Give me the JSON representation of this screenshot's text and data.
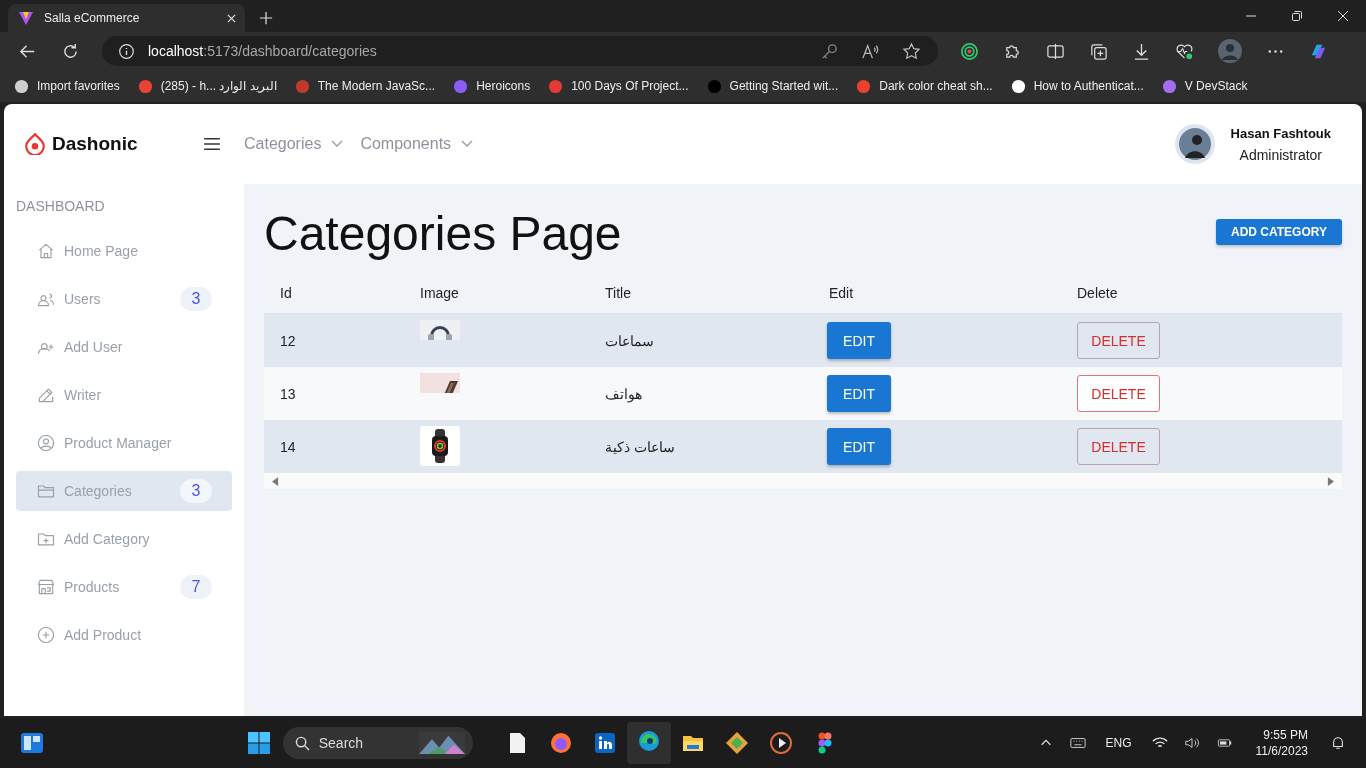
{
  "browser": {
    "tab_title": "Salla eCommerce",
    "url_host": "localhost",
    "url_path": ":5173/dashboard/categories",
    "bookmarks": [
      {
        "label": "Import favorites",
        "color": "#cfcfcf"
      },
      {
        "label": "(285) - h... البريد الوارد",
        "color": "#ea4335"
      },
      {
        "label": "The Modern JavaSc...",
        "color": "#c0392b"
      },
      {
        "label": "Heroicons",
        "color": "#8b5cf6"
      },
      {
        "label": "100 Days Of Project...",
        "color": "#e53935"
      },
      {
        "label": "Getting Started wit...",
        "color": "#000000"
      },
      {
        "label": "Dark color cheat sh...",
        "color": "#e8412c"
      },
      {
        "label": "How to Authenticat...",
        "color": "#ffffff"
      },
      {
        "label": "V DevStack",
        "color": "#a46ef0"
      }
    ]
  },
  "app": {
    "brand": "Dashonic",
    "nav": [
      "Categories",
      "Components"
    ],
    "user": {
      "name": "Hasan Fashtouk",
      "role": "Administrator"
    },
    "sidebar": {
      "section": "DASHBOARD",
      "items": [
        {
          "label": "Home Page",
          "selected": false
        },
        {
          "label": "Users",
          "badge": "3",
          "selected": false
        },
        {
          "label": "Add User",
          "selected": false
        },
        {
          "label": "Writer",
          "selected": false
        },
        {
          "label": "Product Manager",
          "selected": false
        },
        {
          "label": "Categories",
          "badge": "3",
          "selected": true
        },
        {
          "label": "Add Category",
          "selected": false
        },
        {
          "label": "Products",
          "badge": "7",
          "selected": false
        },
        {
          "label": "Add Product",
          "selected": false
        }
      ]
    },
    "page_title": "Categories Page",
    "add_button": "ADD CATEGORY",
    "table": {
      "columns": [
        "Id",
        "Image",
        "Title",
        "Edit",
        "Delete"
      ],
      "rows": [
        {
          "id": "12",
          "title": "سماعات",
          "edit": "EDIT",
          "delete": "DELETE"
        },
        {
          "id": "13",
          "title": "هواتف",
          "edit": "EDIT",
          "delete": "DELETE"
        },
        {
          "id": "14",
          "title": "ساعات ذكية",
          "edit": "EDIT",
          "delete": "DELETE"
        }
      ]
    }
  },
  "taskbar": {
    "search": "Search",
    "language": "ENG",
    "time": "9:55 PM",
    "date": "11/6/2023"
  }
}
